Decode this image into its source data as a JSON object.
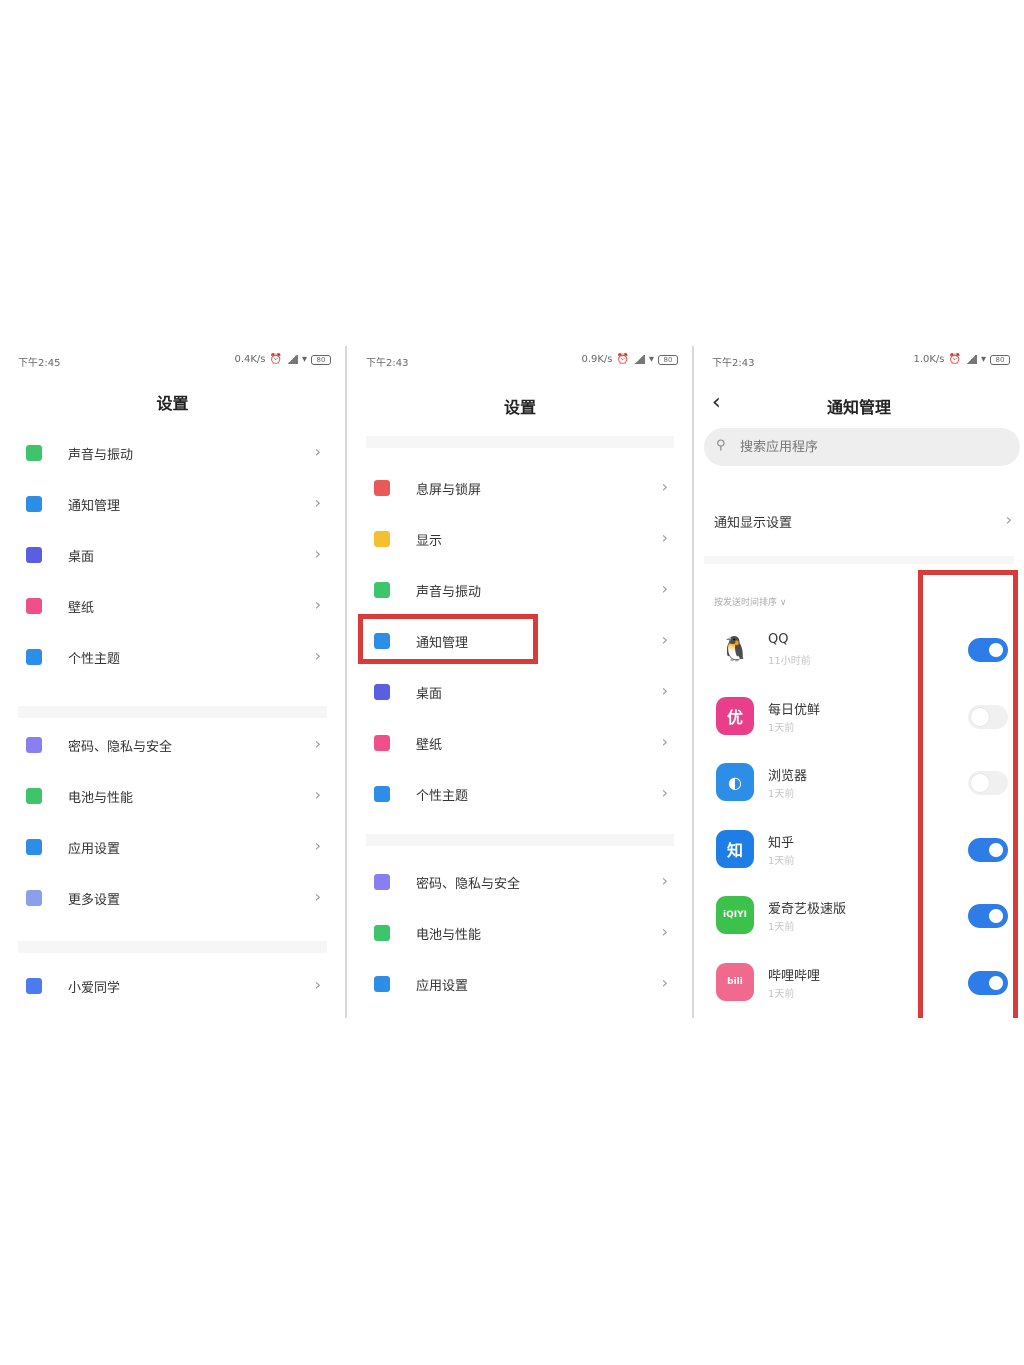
{
  "colors": {
    "accent": "#2d7ce8",
    "highlight_red": "#d93a3a"
  },
  "panel1": {
    "status_time": "下午2:45",
    "status_speed": "0.4K/s",
    "battery": "80",
    "title": "设置",
    "group1": [
      {
        "label": "声音与振动",
        "icon": "speaker-icon",
        "color": "#3ec56b"
      },
      {
        "label": "通知管理",
        "icon": "notification-icon",
        "color": "#2d8ee8"
      },
      {
        "label": "桌面",
        "icon": "home-icon",
        "color": "#5a5ee0"
      },
      {
        "label": "壁纸",
        "icon": "wallpaper-flower-icon",
        "color": "#f0508a"
      },
      {
        "label": "个性主题",
        "icon": "brush-icon",
        "color": "#2d8ee8"
      }
    ],
    "group2": [
      {
        "label": "密码、隐私与安全",
        "icon": "fingerprint-icon",
        "color": "#8a7ef0"
      },
      {
        "label": "电池与性能",
        "icon": "battery-icon",
        "color": "#3ec56b"
      },
      {
        "label": "应用设置",
        "icon": "gear-icon",
        "color": "#2d8ee8"
      },
      {
        "label": "更多设置",
        "icon": "more-icon",
        "color": "#8aa0ea"
      }
    ],
    "group3": [
      {
        "label": "小爱同学",
        "icon": "xiaoai-icon",
        "color": "#4a7cf0"
      }
    ]
  },
  "panel2": {
    "status_time": "下午2:43",
    "status_speed": "0.9K/s",
    "battery": "80",
    "title": "设置",
    "group1": [
      {
        "label": "息屏与锁屏",
        "icon": "lock-icon",
        "color": "#e85a5a"
      },
      {
        "label": "显示",
        "icon": "sun-icon",
        "color": "#f5c030"
      },
      {
        "label": "声音与振动",
        "icon": "speaker-icon",
        "color": "#3ec56b"
      },
      {
        "label": "通知管理",
        "icon": "notification-icon",
        "color": "#2d8ee8"
      },
      {
        "label": "桌面",
        "icon": "home-icon",
        "color": "#5a5ee0"
      },
      {
        "label": "壁纸",
        "icon": "wallpaper-flower-icon",
        "color": "#f0508a"
      },
      {
        "label": "个性主题",
        "icon": "brush-icon",
        "color": "#2d8ee8"
      }
    ],
    "group2": [
      {
        "label": "密码、隐私与安全",
        "icon": "fingerprint-icon",
        "color": "#8a7ef0"
      },
      {
        "label": "电池与性能",
        "icon": "battery-icon",
        "color": "#3ec56b"
      },
      {
        "label": "应用设置",
        "icon": "gear-icon",
        "color": "#2d8ee8"
      }
    ]
  },
  "panel3": {
    "status_time": "下午2:43",
    "status_speed": "1.0K/s",
    "battery": "80",
    "title": "通知管理",
    "search_placeholder": "搜索应用程序",
    "display_settings": "通知显示设置",
    "sort_label": "按发送时间排序 ∨",
    "apps": [
      {
        "name": "QQ",
        "time": "11小时前",
        "enabled": true,
        "icon": "qq-penguin-icon",
        "color": "#ffffff",
        "glyph": "🐧"
      },
      {
        "name": "每日优鲜",
        "time": "1天前",
        "enabled": false,
        "icon": "meiriyouxian-icon",
        "color": "#e83e8c",
        "glyph": "优"
      },
      {
        "name": "浏览器",
        "time": "1天前",
        "enabled": false,
        "icon": "browser-icon",
        "color": "#2d8ee8",
        "glyph": "◐"
      },
      {
        "name": "知乎",
        "time": "1天前",
        "enabled": true,
        "icon": "zhihu-icon",
        "color": "#1e7ee6",
        "glyph": "知"
      },
      {
        "name": "爱奇艺极速版",
        "time": "1天前",
        "enabled": true,
        "icon": "iqiyi-icon",
        "color": "#3cc24a",
        "glyph": "iQIYI"
      },
      {
        "name": "哔哩哔哩",
        "time": "1天前",
        "enabled": true,
        "icon": "bilibili-icon",
        "color": "#f06a90",
        "glyph": "bili"
      }
    ]
  }
}
